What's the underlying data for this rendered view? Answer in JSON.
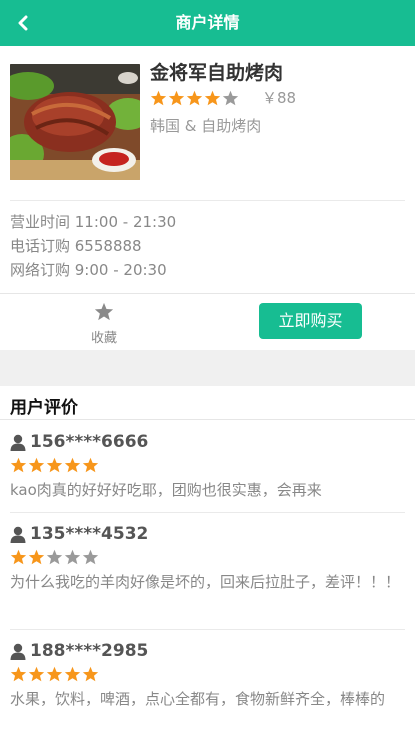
{
  "header": {
    "title": "商户详情",
    "back_icon": "chevron-left-icon"
  },
  "colors": {
    "accent": "#17bd92",
    "star_on": "#f7961b",
    "star_off": "#9a9a9a"
  },
  "shop": {
    "name": "金将军自助烤肉",
    "rating": 4,
    "rating_max": 5,
    "price": "￥88",
    "category": "韩国 & 自助烤肉"
  },
  "info": {
    "hours": "营业时间 11:00 - 21:30",
    "phone": "电话订购 6558888",
    "online": "网络订购 9:00 - 20:30"
  },
  "actions": {
    "favorite_label": "收藏",
    "buy_label": "立即购买"
  },
  "reviews": {
    "title": "用户评价",
    "items": [
      {
        "user": "156****6666",
        "rating": 5,
        "text": "kao肉真的好好好吃耶，团购也很实惠，会再来"
      },
      {
        "user": "135****4532",
        "rating": 2,
        "text": "为什么我吃的羊肉好像是坏的，回来后拉肚子，差评！！！"
      },
      {
        "user": "188****2985",
        "rating": 5,
        "text": "水果，饮料，啤酒，点心全都有，食物新鲜齐全，棒棒的"
      }
    ]
  }
}
